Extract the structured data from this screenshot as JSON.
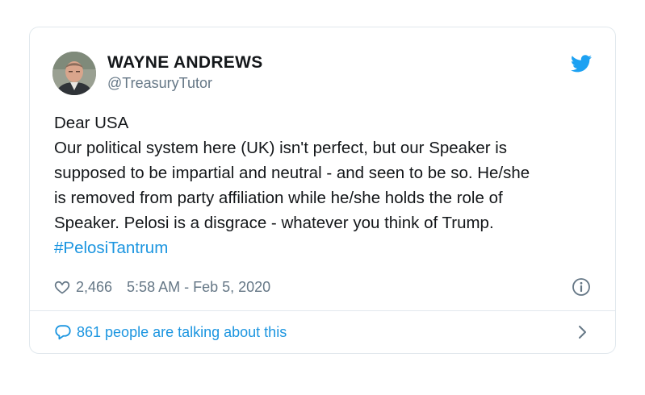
{
  "tweet": {
    "author": {
      "name": "WAYNE ANDREWS",
      "handle": "@TreasuryTutor"
    },
    "body_lines": [
      "Dear USA",
      "Our political system here (UK) isn't perfect, but our Speaker is",
      "supposed to be impartial and neutral - and seen to be so. He/she",
      "is removed from party affiliation while he/she holds the role of",
      "Speaker. Pelosi is a disgrace - whatever you think of Trump."
    ],
    "hashtag": "#PelosiTantrum",
    "likes": "2,466",
    "timestamp": "5:58 AM - Feb 5, 2020",
    "conversation_text": "861 people are talking about this"
  },
  "icons": {
    "brand": "twitter-bird-icon",
    "like": "heart-icon",
    "info": "info-icon",
    "reply": "speech-bubble-icon",
    "more": "chevron-right-icon"
  },
  "colors": {
    "link": "#1b95e0",
    "twitter_brand": "#1da1f2",
    "secondary_text": "#657786",
    "border": "#e1e8ed",
    "primary_text": "#14171a"
  }
}
